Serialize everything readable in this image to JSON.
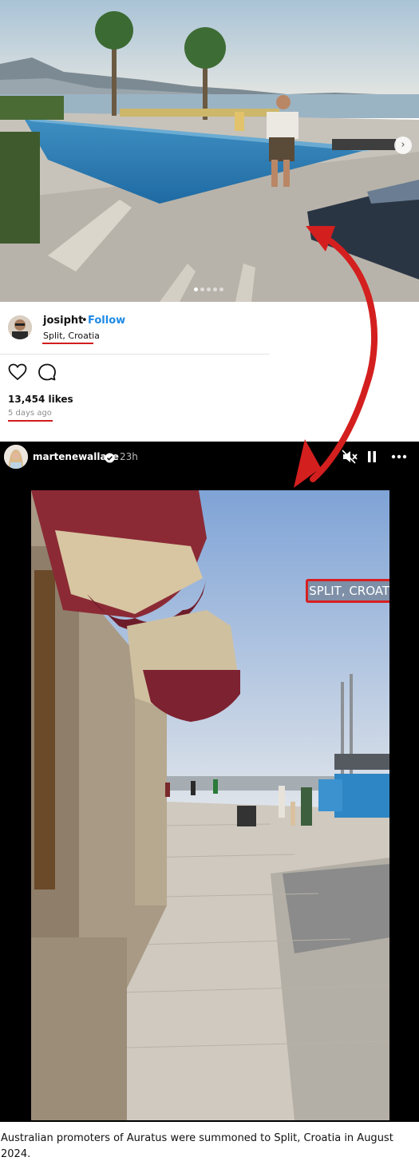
{
  "post": {
    "username": "josipht",
    "dot": "•",
    "follow_label": "Follow",
    "location": "Split, Croatia",
    "likes": "13,454 likes",
    "time": "5 days ago",
    "carousel_count": 5,
    "carousel_active": 1
  },
  "story": {
    "username": "martenewallace",
    "time": "23h",
    "location_sticker": "SPLIT, CROATIA"
  },
  "caption": "Australian promoters of Auratus were summoned to Split, Croatia in August 2024.",
  "colors": {
    "follow_blue": "#1f8ae5",
    "highlight_red": "#d21d1d",
    "story_bg": "#000000"
  },
  "icons": [
    "heart-icon",
    "comment-icon",
    "verified-icon",
    "mute-icon",
    "pause-icon",
    "more-icon",
    "next-arrow-icon"
  ]
}
